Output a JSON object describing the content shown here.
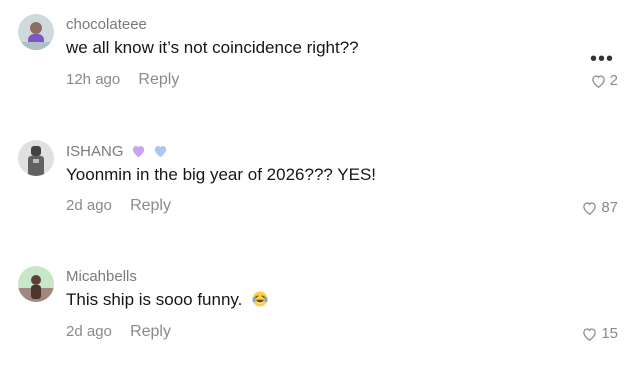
{
  "comments": [
    {
      "username": "chocolateee",
      "text": "we all know it’s not coincidence right??",
      "time": "12h ago",
      "reply_label": "Reply",
      "likes": "2",
      "avatar_icon": "user-avatar"
    },
    {
      "username": "ISHANG",
      "badges": [
        "purple-heart-icon",
        "blue-heart-icon"
      ],
      "text": "Yoonmin in the big year of 2026??? YES!",
      "time": "2d ago",
      "reply_label": "Reply",
      "likes": "87",
      "avatar_icon": "user-avatar"
    },
    {
      "username": "Micahbells",
      "text": "This ship is sooo funny.",
      "emoji": "laughing-crying-emoji",
      "time": "2d ago",
      "reply_label": "Reply",
      "likes": "15",
      "avatar_icon": "user-avatar"
    }
  ],
  "more_options_icon": "ellipsis-icon",
  "colors": {
    "text_primary": "#161616",
    "text_secondary": "#8a8a8a",
    "badge_purple": "#c9a3f0",
    "badge_blue": "#a9c8f5"
  }
}
